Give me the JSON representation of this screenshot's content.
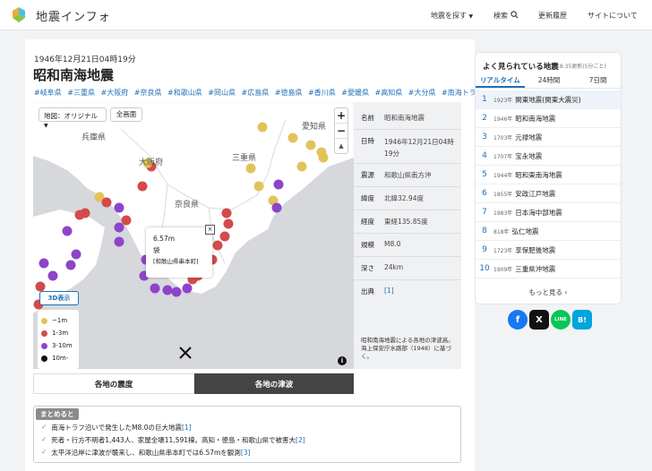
{
  "header": {
    "logo_text": "地震インフォ",
    "nav": {
      "search_quake": "地震を探す",
      "search": "検索",
      "history": "更新履歴",
      "about": "サイトについて"
    }
  },
  "quake": {
    "date": "1946年12月21日04時19分",
    "title": "昭和南海地震",
    "tags": [
      "#岐阜県",
      "#三重県",
      "#大阪府",
      "#奈良県",
      "#和歌山県",
      "#岡山県",
      "#広島県",
      "#徳島県",
      "#香川県",
      "#愛媛県",
      "#高知県",
      "#大分県",
      "#南海トラフ"
    ]
  },
  "map": {
    "type_select": "地図：オリジナル",
    "fullscreen": "全画面",
    "zoom_in": "+",
    "zoom_out": "−",
    "compass": "▲",
    "labels": {
      "hyogo": "兵庫県",
      "aichi": "愛知県",
      "mie": "三重県",
      "nara": "奈良県",
      "osaka": "大阪府"
    },
    "btn_3d": "3D表示",
    "legend": [
      {
        "label": "~1m",
        "color": "#e2c35a"
      },
      {
        "label": "1-3m",
        "color": "#d34b4b"
      },
      {
        "label": "3-10m",
        "color": "#8e44c9"
      },
      {
        "label": "10m-",
        "color": "#111111"
      }
    ],
    "popup": {
      "height": "6.57m",
      "place": "袋",
      "location": "[和歌山県串本町]",
      "close": "×"
    },
    "info_icon": "i"
  },
  "info": {
    "rows": [
      {
        "k": "名前",
        "v": "昭和南海地震"
      },
      {
        "k": "日時",
        "v": "1946年12月21日04時19分"
      },
      {
        "k": "震源",
        "v": "和歌山県南方沖"
      },
      {
        "k": "緯度",
        "v": "北緯32.94度"
      },
      {
        "k": "経度",
        "v": "東経135.85度"
      },
      {
        "k": "規模",
        "v": "M8.0"
      },
      {
        "k": "深さ",
        "v": "24km"
      },
      {
        "k": "出典",
        "v": "[1]"
      }
    ],
    "caption": "昭和南海地震による各地の津波高。海上保安庁水路部（1948）に基づく。"
  },
  "tabs": {
    "intensity": "各地の震度",
    "tsunami": "各地の津波"
  },
  "summary": {
    "badge": "まとめると",
    "lines": [
      {
        "text": "南海トラフ沿いで発生したM8.0の巨大地震",
        "ref": "[1]"
      },
      {
        "text": "死者・行方不明者1,443人、家屋全壊11,591棟。高知・徳島・和歌山県で被害大",
        "ref": "[2]"
      },
      {
        "text": "太平洋沿岸に津波が襲来し、和歌山県串本町では6.57mを観測",
        "ref": "[3]"
      }
    ]
  },
  "sidebar": {
    "title": "よく見られている地震",
    "sub": "18:35更新(5分ごと)",
    "tabs": [
      "リアルタイム",
      "24時間",
      "7日間"
    ],
    "items": [
      {
        "n": "1",
        "y": "1923年",
        "t": "関東地震(関東大震災)"
      },
      {
        "n": "2",
        "y": "1946年",
        "t": "昭和南海地震"
      },
      {
        "n": "3",
        "y": "1703年",
        "t": "元禄地震"
      },
      {
        "n": "4",
        "y": "1707年",
        "t": "宝永地震"
      },
      {
        "n": "5",
        "y": "1944年",
        "t": "昭和東南海地震"
      },
      {
        "n": "6",
        "y": "1855年",
        "t": "安政江戸地震"
      },
      {
        "n": "7",
        "y": "1983年",
        "t": "日本海中部地震"
      },
      {
        "n": "8",
        "y": "818年",
        "t": "弘仁地震"
      },
      {
        "n": "9",
        "y": "1723年",
        "t": "享保肥後地震"
      },
      {
        "n": "10",
        "y": "1909年",
        "t": "三重県沖地震"
      }
    ],
    "more": "もっと見る ›"
  },
  "share": {
    "facebook": "f",
    "x": "X",
    "line": "LINE",
    "hatena": "B!"
  },
  "colors": {
    "accent": "#1f6fb8",
    "sea": "#d6d8db",
    "land": "#ffffff",
    "tab_dark": "#444444"
  }
}
